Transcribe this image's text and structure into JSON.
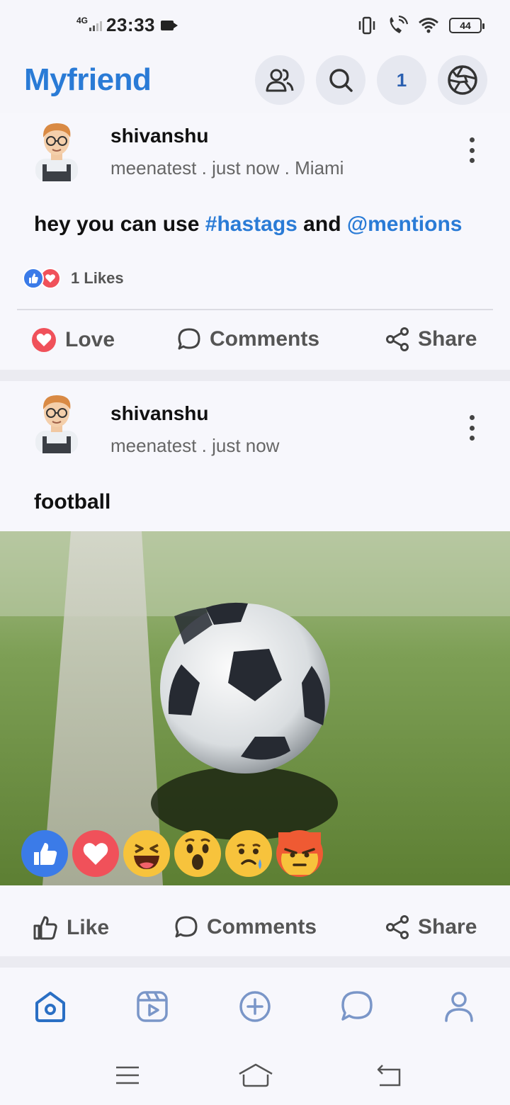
{
  "status": {
    "network": "4G",
    "time": "23:33",
    "battery": "44"
  },
  "header": {
    "app_name": "Myfriend",
    "notification_count": "1"
  },
  "posts": [
    {
      "author": "shivanshu",
      "meta_user": "meenatest",
      "meta_sep": " . ",
      "meta_time": "just now . Miami",
      "text_plain": "hey you can use ",
      "text_hashtag": "#hastags",
      "text_mid": " and ",
      "text_mention": "@mentions",
      "likes": "1 Likes",
      "actions": {
        "love": "Love",
        "comments": "Comments",
        "share": "Share"
      }
    },
    {
      "author": "shivanshu",
      "meta_user": "meenatest",
      "meta_sep": " . ",
      "meta_time": "just now",
      "text": "football",
      "actions": {
        "like": "Like",
        "comments": "Comments",
        "share": "Share"
      }
    }
  ],
  "reactions": [
    "like",
    "love",
    "haha",
    "wow",
    "sad",
    "angry"
  ],
  "colors": {
    "accent": "#2a7bd6",
    "love": "#f0515a",
    "like": "#3b7be8",
    "emoji": "#f7c33c",
    "angry": "#ef5a33"
  },
  "icons": {
    "header": [
      "friends-icon",
      "search-icon",
      "camera-shutter-icon"
    ],
    "bottom_nav": [
      "home-icon",
      "reels-icon",
      "add-icon",
      "chat-icon",
      "profile-icon"
    ],
    "system_nav": [
      "menu-icon",
      "home-outline-icon",
      "back-icon"
    ]
  }
}
